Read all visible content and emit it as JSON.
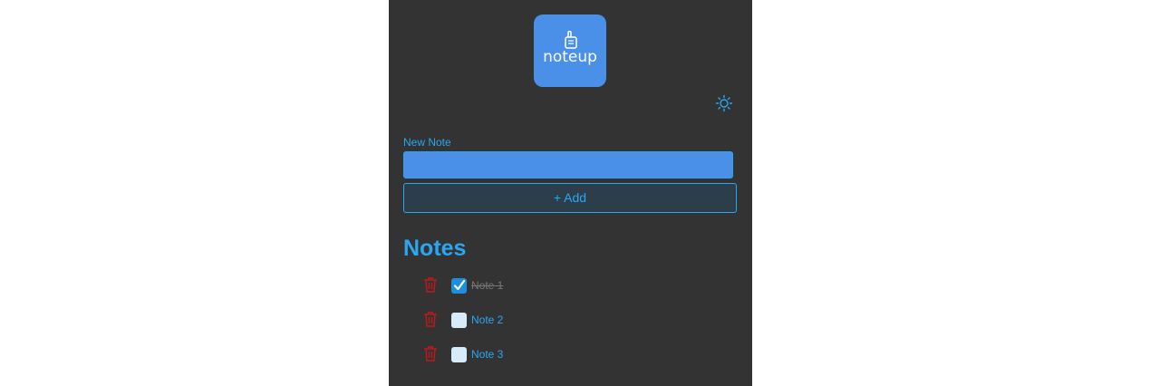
{
  "logo": {
    "text": "noteup"
  },
  "header": {
    "theme_toggle_icon": "sun-icon"
  },
  "form": {
    "label": "New Note",
    "input_value": "",
    "add_label": "+ Add"
  },
  "notes": {
    "heading": "Notes",
    "items": [
      {
        "label": "Note 1",
        "done": true
      },
      {
        "label": "Note 2",
        "done": false
      },
      {
        "label": "Note 3",
        "done": false
      }
    ]
  },
  "colors": {
    "app_background": "#333333",
    "accent": "#29a7f5",
    "logo_background": "#4a8fe8",
    "delete": "#c0191c"
  }
}
